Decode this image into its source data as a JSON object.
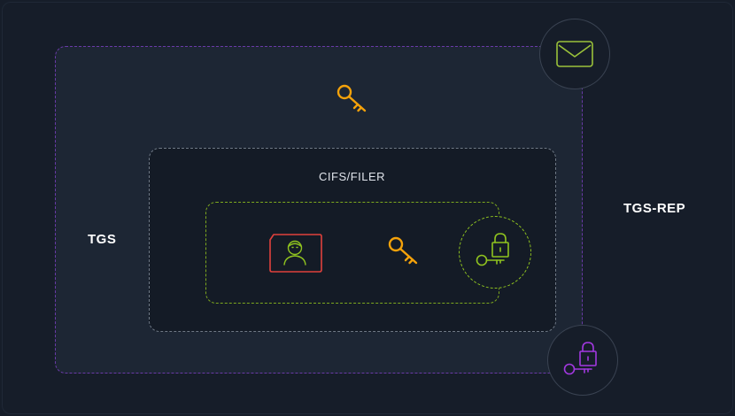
{
  "labels": {
    "tgs": "TGS",
    "tgs_rep": "TGS-REP",
    "service": "CIFS/FILER"
  },
  "colors": {
    "key_orange": "#f5a20a",
    "card_red": "#e0413c",
    "user_green": "#8fc31f",
    "lock_green": "#8fc31f",
    "lock_purple": "#a238e0",
    "envelope_green": "#9bc23a",
    "outer_border": "#6a3aa8",
    "inner_border": "#7da81e"
  },
  "icons": [
    "envelope-icon",
    "key-icon",
    "user-card-icon",
    "key-icon",
    "key-lock-icon",
    "key-lock-icon"
  ]
}
